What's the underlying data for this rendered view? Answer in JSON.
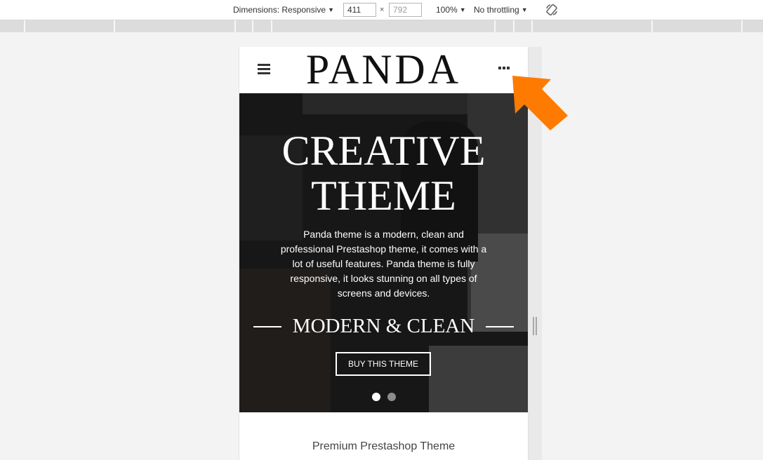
{
  "devtools": {
    "dimensions_label": "Dimensions: Responsive",
    "width_value": "411",
    "times_symbol": "×",
    "height_value": "792",
    "zoom": "100%",
    "throttling": "No throttling"
  },
  "site": {
    "logo": "PANDA",
    "hero": {
      "title_line1": "CREATIVE",
      "title_line2": "THEME",
      "description": "Panda theme is a modern, clean and professional Prestashop theme, it comes with a lot of useful features. Panda theme is fully responsive, it looks stunning on all types of screens and devices.",
      "tagline": "MODERN & CLEAN",
      "cta_label": "BUY THIS THEME",
      "slide_count": 2,
      "active_slide": 1
    },
    "subtitle": "Premium Prestashop Theme"
  },
  "colors": {
    "arrow": "#ff7a00",
    "page_bg": "#f3f3f3"
  }
}
